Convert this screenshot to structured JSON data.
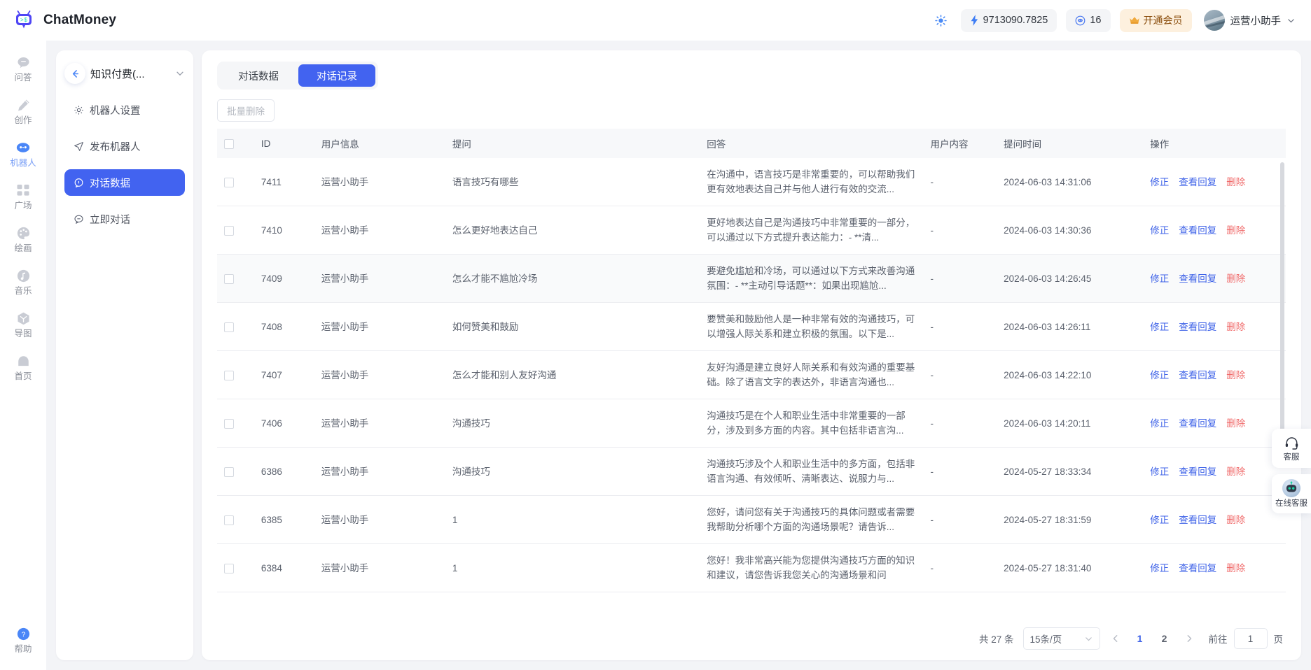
{
  "header": {
    "brand_name": "ChatMoney",
    "logo_icon": "chatmoney-logo-icon",
    "theme_icon": "sun-icon",
    "balance": "9713090.7825",
    "balance_icon": "lightning-icon",
    "messages_count": "16",
    "messages_icon": "chat-bubble-icon",
    "vip_label": "开通会员",
    "vip_icon": "crown-icon",
    "username": "运营小助手",
    "caret_icon": "chevron-down-icon"
  },
  "rail": {
    "items": [
      {
        "label": "问答",
        "icon": "chat-icon",
        "active": false
      },
      {
        "label": "创作",
        "icon": "pencil-icon",
        "active": false
      },
      {
        "label": "机器人",
        "icon": "robot-icon",
        "active": true
      },
      {
        "label": "广场",
        "icon": "grid-icon",
        "active": false
      },
      {
        "label": "绘画",
        "icon": "palette-icon",
        "active": false
      },
      {
        "label": "音乐",
        "icon": "music-note-icon",
        "active": false
      },
      {
        "label": "导图",
        "icon": "mindmap-icon",
        "active": false
      },
      {
        "label": "首页",
        "icon": "home-icon",
        "active": false
      }
    ],
    "bottom": {
      "label": "帮助",
      "icon": "question-circle-icon"
    }
  },
  "sidebar": {
    "back_icon": "arrow-left-icon",
    "title": "知识付费(...",
    "caret_icon": "chevron-down-icon",
    "items": [
      {
        "label": "机器人设置",
        "icon": "gear-icon",
        "active": false
      },
      {
        "label": "发布机器人",
        "icon": "send-icon",
        "active": false
      },
      {
        "label": "对话数据",
        "icon": "chat-circle-icon",
        "active": true
      },
      {
        "label": "立即对话",
        "icon": "message-icon",
        "active": false
      }
    ]
  },
  "main": {
    "tabs": [
      {
        "label": "对话数据",
        "active": false
      },
      {
        "label": "对话记录",
        "active": true
      }
    ],
    "batch_delete_label": "批量删除",
    "columns": [
      "ID",
      "用户信息",
      "提问",
      "回答",
      "用户内容",
      "提问时间",
      "操作"
    ],
    "actions": {
      "edit": "修正",
      "view": "查看回复",
      "delete": "删除"
    },
    "rows": [
      {
        "id": "7411",
        "user": "运营小助手",
        "question": "语言技巧有哪些",
        "answer": "在沟通中，语言技巧是非常重要的，可以帮助我们更有效地表达自己并与他人进行有效的交流...",
        "user_content": "-",
        "time": "2024-06-03 14:31:06"
      },
      {
        "id": "7410",
        "user": "运营小助手",
        "question": "怎么更好地表达自己",
        "answer": "更好地表达自己是沟通技巧中非常重要的一部分，可以通过以下方式提升表达能力：- **清...",
        "user_content": "-",
        "time": "2024-06-03 14:30:36"
      },
      {
        "id": "7409",
        "user": "运营小助手",
        "question": "怎么才能不尴尬冷场",
        "answer": "要避免尴尬和冷场，可以通过以下方式来改善沟通氛围：- **主动引导话题**：如果出现尴尬...",
        "user_content": "-",
        "time": "2024-06-03 14:26:45"
      },
      {
        "id": "7408",
        "user": "运营小助手",
        "question": "如何赞美和鼓励",
        "answer": "要赞美和鼓励他人是一种非常有效的沟通技巧，可以增强人际关系和建立积极的氛围。以下是...",
        "user_content": "-",
        "time": "2024-06-03 14:26:11"
      },
      {
        "id": "7407",
        "user": "运营小助手",
        "question": "怎么才能和别人友好沟通",
        "answer": "友好沟通是建立良好人际关系和有效沟通的重要基础。除了语言文字的表达外，非语言沟通也...",
        "user_content": "-",
        "time": "2024-06-03 14:22:10"
      },
      {
        "id": "7406",
        "user": "运营小助手",
        "question": "沟通技巧",
        "answer": "沟通技巧是在个人和职业生活中非常重要的一部分，涉及到多方面的内容。其中包括非语言沟...",
        "user_content": "-",
        "time": "2024-06-03 14:20:11"
      },
      {
        "id": "6386",
        "user": "运营小助手",
        "question": "沟通技巧",
        "answer": "沟通技巧涉及个人和职业生活中的多方面，包括非语言沟通、有效倾听、清晰表达、说服力与...",
        "user_content": "-",
        "time": "2024-05-27 18:33:34"
      },
      {
        "id": "6385",
        "user": "运营小助手",
        "question": "1",
        "answer": "您好，请问您有关于沟通技巧的具体问题或者需要我帮助分析哪个方面的沟通场景呢？请告诉...",
        "user_content": "-",
        "time": "2024-05-27 18:31:59"
      },
      {
        "id": "6384",
        "user": "运营小助手",
        "question": "1",
        "answer": "您好！我非常高兴能为您提供沟通技巧方面的知识和建议，请您告诉我您关心的沟通场景和问",
        "user_content": "-",
        "time": "2024-05-27 18:31:40"
      }
    ]
  },
  "pagination": {
    "total_label": "共 27 条",
    "page_size": "15条/页",
    "prev_icon": "chevron-left-icon",
    "next_icon": "chevron-right-icon",
    "pages": [
      "1",
      "2"
    ],
    "current_page": "1",
    "jump_label": "前往",
    "jump_value": "1",
    "page_unit": "页"
  },
  "float_dock": [
    {
      "label": "客服",
      "icon": "headset-icon"
    },
    {
      "label": "在线客服",
      "icon": "robot-avatar-icon"
    }
  ],
  "colors": {
    "accent": "#4263f0",
    "link": "#3f63e8",
    "danger": "#f06a6a",
    "vip_bg": "#fdf0de",
    "page_bg": "#f3f4f7"
  }
}
